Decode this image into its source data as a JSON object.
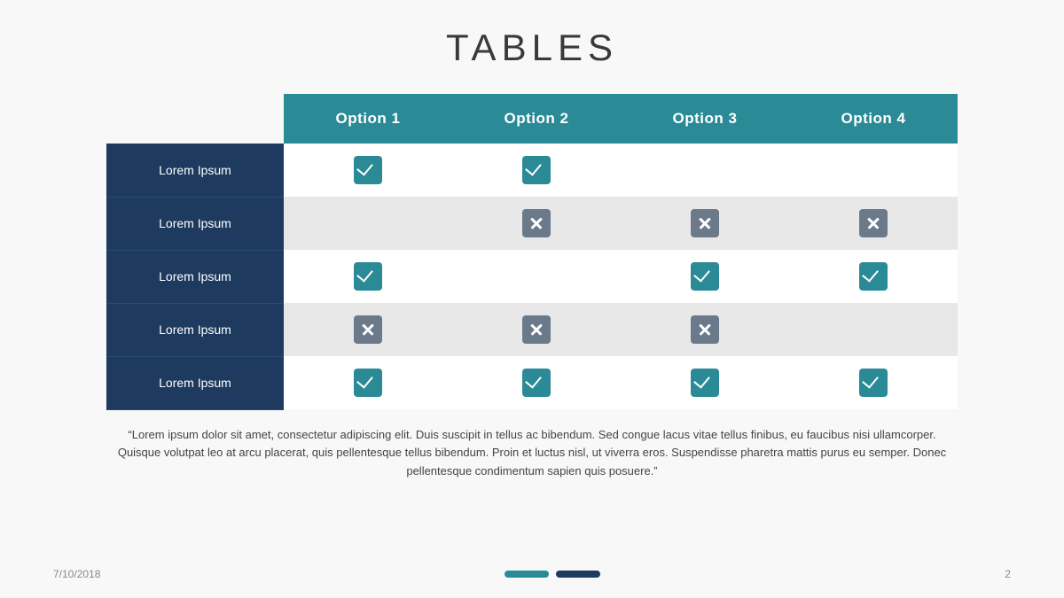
{
  "title": "TABLES",
  "table": {
    "columns": [
      "",
      "Option 1",
      "Option 2",
      "Option 3",
      "Option 4"
    ],
    "rows": [
      {
        "header": "Lorem Ipsum",
        "cells": [
          "check",
          "check",
          "empty",
          "empty"
        ]
      },
      {
        "header": "Lorem Ipsum",
        "cells": [
          "empty",
          "cross",
          "cross",
          "cross"
        ]
      },
      {
        "header": "Lorem Ipsum",
        "cells": [
          "check",
          "empty",
          "check",
          "check"
        ]
      },
      {
        "header": "Lorem Ipsum",
        "cells": [
          "cross",
          "cross",
          "cross",
          "empty"
        ]
      },
      {
        "header": "Lorem Ipsum",
        "cells": [
          "check",
          "check",
          "check",
          "check"
        ]
      }
    ]
  },
  "quote": "“Lorem ipsum dolor sit amet, consectetur adipiscing elit. Duis suscipit in tellus ac bibendum. Sed congue lacus vitae tellus finibus, eu faucibus nisi ullamcorper. Quisque volutpat leo at arcu placerat,  quis pellentesque tellus bibendum. Proin et luctus nisl, ut viverra eros. Suspendisse pharetra mattis purus eu semper. Donec pellentesque condimentum sapien quis posuere.”",
  "footer": {
    "date": "7/10/2018",
    "page": "2"
  }
}
